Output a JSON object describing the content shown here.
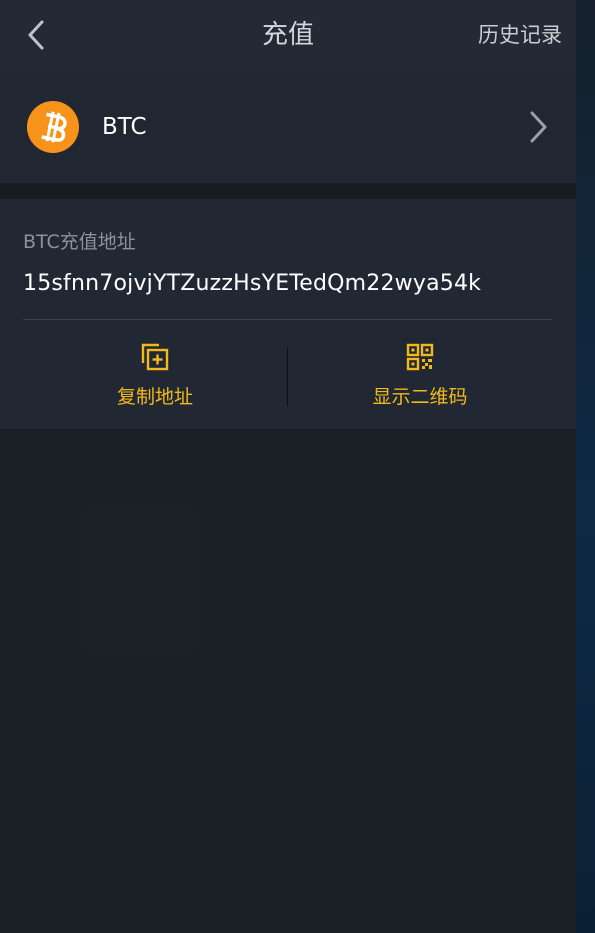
{
  "header": {
    "title": "充值",
    "history_label": "历史记录",
    "back_icon": "chevron-left-icon"
  },
  "coin": {
    "name": "BTC",
    "logo_icon": "bitcoin-logo-icon",
    "logo_color": "#f7931a",
    "chevron_icon": "chevron-right-icon"
  },
  "address": {
    "label": "BTC充值地址",
    "value": "15sfnn7ojvjYTZuzzHsYETedQm22wya54k"
  },
  "actions": {
    "copy_label": "复制地址",
    "copy_icon": "copy-add-icon",
    "qr_label": "显示二维码",
    "qr_icon": "qr-code-icon",
    "accent_color": "#f2b91a"
  }
}
